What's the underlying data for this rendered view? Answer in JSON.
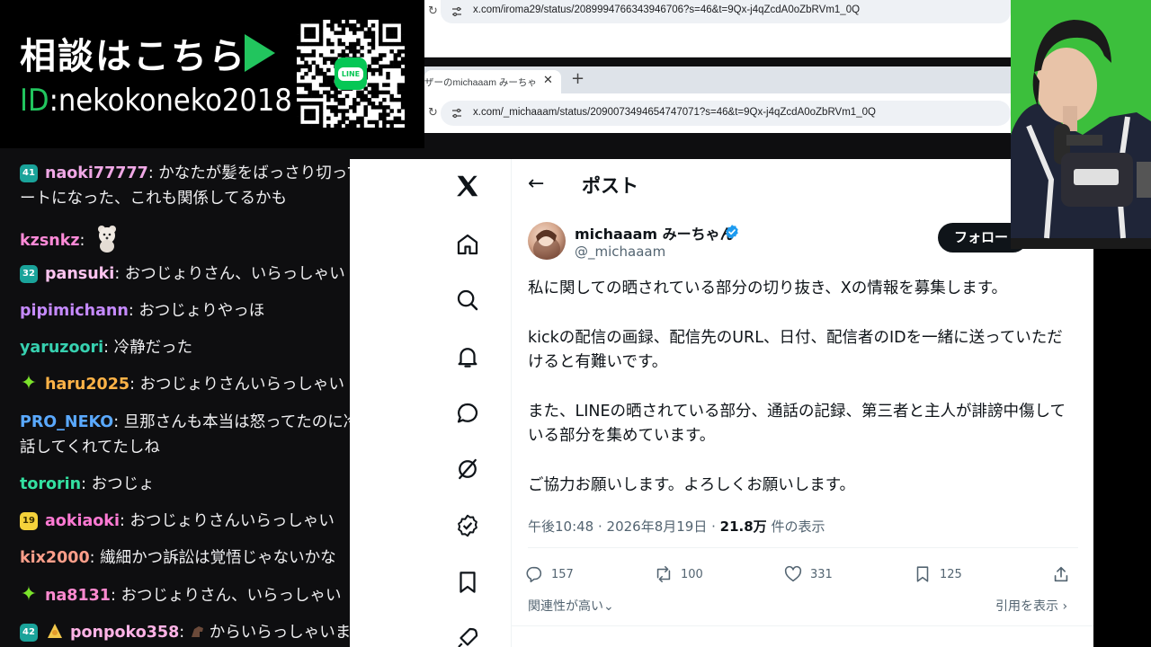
{
  "overlay": {
    "title": "相談はこちら",
    "id_prefix": "ID",
    "id_value": ":nekokoneko2018",
    "qr_badge": "LINE",
    "accent_color": "#22c55e"
  },
  "chat": {
    "messages": [
      {
        "badge": "41",
        "user": "naoki77777",
        "color": "#f0a8e6",
        "text": "かなたが髪をばっさり切って",
        "text2": "ートになった、これも関係してるかも"
      },
      {
        "badge": "",
        "user": "kzsnkz",
        "color": "#ff8ad8",
        "text": ""
      },
      {
        "badge": "32",
        "user": "pansuki",
        "color": "#ffc4f0",
        "text": "おつじょりさん、いらっしゃい"
      },
      {
        "badge": "",
        "user": "pipimichann",
        "color": "#c58aff",
        "text": "おつじょりやっほ"
      },
      {
        "badge": "",
        "user": "yaruzoori",
        "color": "#37d1b0",
        "text": "冷静だった"
      },
      {
        "badge": "sparkle",
        "user": "haru2025",
        "color": "#ffb347",
        "text": "おつじょりさんいらっしゃい"
      },
      {
        "badge": "",
        "user": "PRO_NEKO",
        "color": "#5aa9ff",
        "text": "旦那さんも本当は怒ってたのに冷",
        "text2": "話してくれてたしね"
      },
      {
        "badge": "",
        "user": "tororin",
        "color": "#33e0a0",
        "text": "おつじょ"
      },
      {
        "badge": "19",
        "user": "aokiaoki",
        "color": "#ff7ad4",
        "text": "おつじょりさんいらっしゃい"
      },
      {
        "badge": "",
        "user": "kix2000",
        "color": "#ff9f8a",
        "text": "繊細かつ訴訟は覚悟じゃないかな"
      },
      {
        "badge": "sparkle",
        "user": "na8131",
        "color": "#ff8ad0",
        "text": "おつじょりさん、いらっしゃい"
      },
      {
        "badge": "42",
        "user": "ponpoko358",
        "color": "#ffb3e6",
        "text": "からいらっしゃいま"
      }
    ]
  },
  "browser": {
    "win1_url": "x.com/iroma29/status/2089994766343946706?s=46&t=9Qx-j4qZcdA0oZbRVm1_0Q",
    "win2_tab_title": "ザーのmichaaam みーちゃん",
    "win2_url": "x.com/_michaaam/status/2090073494654747071?s=46&t=9Qx-j4qZcdA0oZbRVm1_0Q"
  },
  "post": {
    "heading": "ポスト",
    "author": "michaaam みーちゃん",
    "handle": "@_michaaam",
    "follow_label": "フォロー",
    "paragraphs": [
      "私に関しての晒されている部分の切り抜き、Xの情報を募集します。",
      "kickの配信の画録、配信先のURL、日付、配信者のIDを一緒に送っていただけると有難いです。",
      "また、LINEの晒されている部分、通話の記録、第三者と主人が誹謗中傷している部分を集めています。",
      "ご協力お願いします。よろしくお願いします。"
    ],
    "time": "午後10:48",
    "date": "2026年8月19日",
    "views": "21.8万",
    "views_suffix": " 件の表示",
    "replies": "157",
    "reposts": "100",
    "likes": "331",
    "bookmarks": "125",
    "relevance": "関連性が高い",
    "quotes": "引用を表示"
  },
  "colors": {
    "x_black": "#0f1419",
    "x_gray": "#536471",
    "verified_blue": "#1d9bf0",
    "chat_bg": "#0e0e10",
    "cam_green": "#3cbf3c"
  }
}
